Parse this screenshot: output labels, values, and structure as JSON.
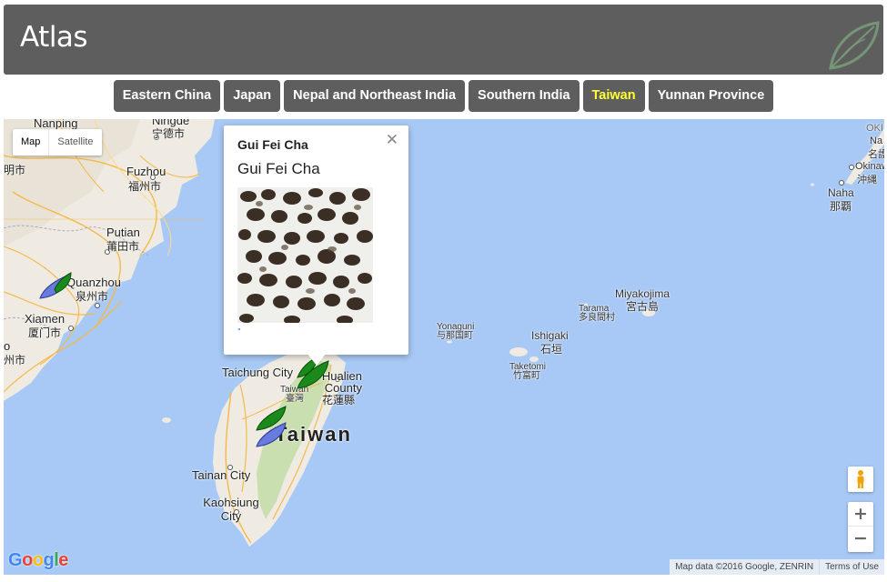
{
  "header": {
    "title": "Atlas",
    "logo_icon": "leaf-icon"
  },
  "tabs": [
    {
      "label": "Eastern China",
      "active": false
    },
    {
      "label": "Japan",
      "active": false
    },
    {
      "label": "Nepal and Northeast India",
      "active": false
    },
    {
      "label": "Southern India",
      "active": false
    },
    {
      "label": "Taiwan",
      "active": true
    },
    {
      "label": "Yunnan Province",
      "active": false
    }
  ],
  "map": {
    "map_type": {
      "map": "Map",
      "satellite": "Satellite",
      "selected": "Map"
    },
    "labels": {
      "nanping": "Nanping",
      "ningde": "Ningde",
      "ningde_han": "宁德市",
      "fuzhou": "Fuzhou",
      "fuzhou_han": "福州市",
      "putian": "Putian",
      "putian_han": "莆田市",
      "quanzhou": "Quanzhou",
      "quanzhou_han": "泉州市",
      "xiamen": "Xiamen",
      "xiamen_han": "厦门市",
      "left_partial_1": "明市",
      "left_partial_2": "州市",
      "left_partial_3": "o",
      "taichung": "Taichung City",
      "taiwan_small": "Taiwan",
      "taiwan_small_han": "臺灣",
      "hualien": "Hualien County",
      "hualien_han": "花蓮縣",
      "taiwan_big": "Taiwan",
      "tainan": "Tainan City",
      "kaohsiung": "Kaohsiung City",
      "yonaguni": "Yonaguni",
      "yonaguni_han": "与那国町",
      "ishigaki": "Ishigaki",
      "ishigaki_han": "石垣",
      "taketomi": "Taketomi",
      "taketomi_han": "竹富町",
      "tarama": "Tarama",
      "tarama_han": "多良間村",
      "miyakojima": "Miyakojima",
      "miyakojima_han": "宮古島",
      "okinawa": "Okinawa",
      "okinawa_han": "沖縄",
      "naha": "Naha",
      "naha_han": "那覇",
      "top_right_1": "OKI",
      "top_right_2": "Na",
      "top_right_3": "名護"
    },
    "popup": {
      "title": "Gui Fei Cha",
      "subtitle": "Gui Fei Cha",
      "link": "\"",
      "close_icon": "close-icon"
    },
    "markers": [
      {
        "name": "quanzhou-tea-marker",
        "icon": "leaf-marker-icon"
      },
      {
        "name": "hualien-tea-marker",
        "icon": "leaf-marker-icon"
      },
      {
        "name": "central-taiwan-tea-marker",
        "icon": "leaf-marker-icon"
      }
    ],
    "controls": {
      "zoom_in": "+",
      "zoom_out": "−",
      "pegman_icon": "pegman-icon"
    },
    "logo": "Google",
    "attribution": "Map data ©2016 Google, ZENRIN",
    "terms": "Terms of Use"
  },
  "colors": {
    "header_bg": "#5e5e5e",
    "tab_bg": "#5e5e5e",
    "tab_active_text": "#ffff33",
    "water": "#a8c9f5",
    "land": "#efebe2",
    "forest": "#c9dfaf",
    "road": "#f5b94a"
  }
}
